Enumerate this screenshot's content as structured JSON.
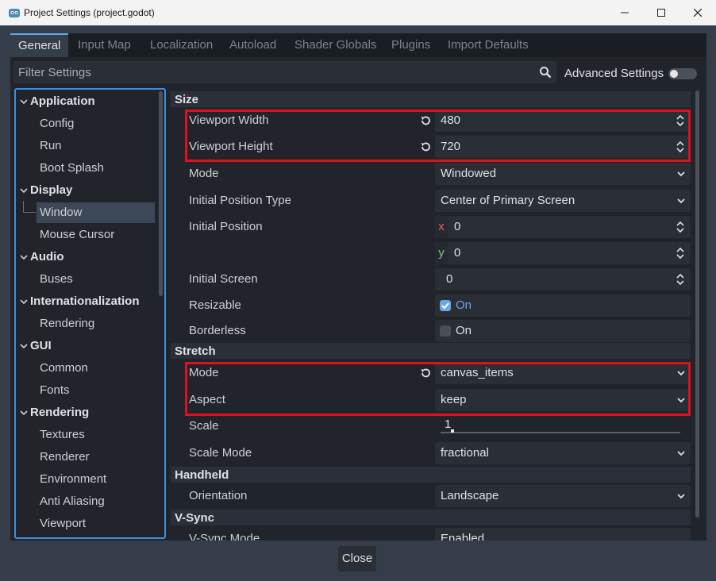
{
  "window": {
    "title": "Project Settings (project.godot)"
  },
  "tabs": [
    {
      "label": "General",
      "active": true
    },
    {
      "label": "Input Map"
    },
    {
      "label": "Localization"
    },
    {
      "label": "Autoload"
    },
    {
      "label": "Shader Globals"
    },
    {
      "label": "Plugins"
    },
    {
      "label": "Import Defaults"
    }
  ],
  "filter": {
    "placeholder": "Filter Settings",
    "advanced_label": "Advanced Settings",
    "advanced_enabled": false
  },
  "tree": [
    {
      "label": "Application",
      "category": true
    },
    {
      "label": "Config"
    },
    {
      "label": "Run"
    },
    {
      "label": "Boot Splash"
    },
    {
      "label": "Display",
      "category": true
    },
    {
      "label": "Window",
      "selected": true
    },
    {
      "label": "Mouse Cursor"
    },
    {
      "label": "Audio",
      "category": true
    },
    {
      "label": "Buses"
    },
    {
      "label": "Internationalization",
      "category": true
    },
    {
      "label": "Rendering"
    },
    {
      "label": "GUI",
      "category": true
    },
    {
      "label": "Common"
    },
    {
      "label": "Fonts"
    },
    {
      "label": "Rendering",
      "category": true
    },
    {
      "label": "Textures"
    },
    {
      "label": "Renderer"
    },
    {
      "label": "Environment"
    },
    {
      "label": "Anti Aliasing"
    },
    {
      "label": "Viewport"
    }
  ],
  "sections": {
    "size": "Size",
    "stretch": "Stretch",
    "handheld": "Handheld",
    "vsync": "V-Sync"
  },
  "props": {
    "viewport_width": {
      "label": "Viewport Width",
      "value": "480"
    },
    "viewport_height": {
      "label": "Viewport Height",
      "value": "720"
    },
    "mode": {
      "label": "Mode",
      "value": "Windowed"
    },
    "initial_position_type": {
      "label": "Initial Position Type",
      "value": "Center of Primary Screen"
    },
    "initial_position": {
      "label": "Initial Position",
      "x_axis": "x",
      "x": "0",
      "y_axis": "y",
      "y": "0"
    },
    "initial_screen": {
      "label": "Initial Screen",
      "value": "0"
    },
    "resizable": {
      "label": "Resizable",
      "value": "On",
      "checked": true
    },
    "borderless": {
      "label": "Borderless",
      "value": "On",
      "checked": false
    },
    "stretch_mode": {
      "label": "Mode",
      "value": "canvas_items"
    },
    "aspect": {
      "label": "Aspect",
      "value": "keep"
    },
    "scale": {
      "label": "Scale",
      "value": "1"
    },
    "scale_mode": {
      "label": "Scale Mode",
      "value": "fractional"
    },
    "orientation": {
      "label": "Orientation",
      "value": "Landscape"
    },
    "vsync_mode": {
      "label": "V-Sync Mode",
      "value": "Enabled"
    }
  },
  "footer": {
    "close_label": "Close"
  },
  "colors": {
    "accent": "#5fa8ea",
    "highlight": "#e10f1f",
    "x_axis": "#e0606a",
    "y_axis": "#6fce77"
  }
}
